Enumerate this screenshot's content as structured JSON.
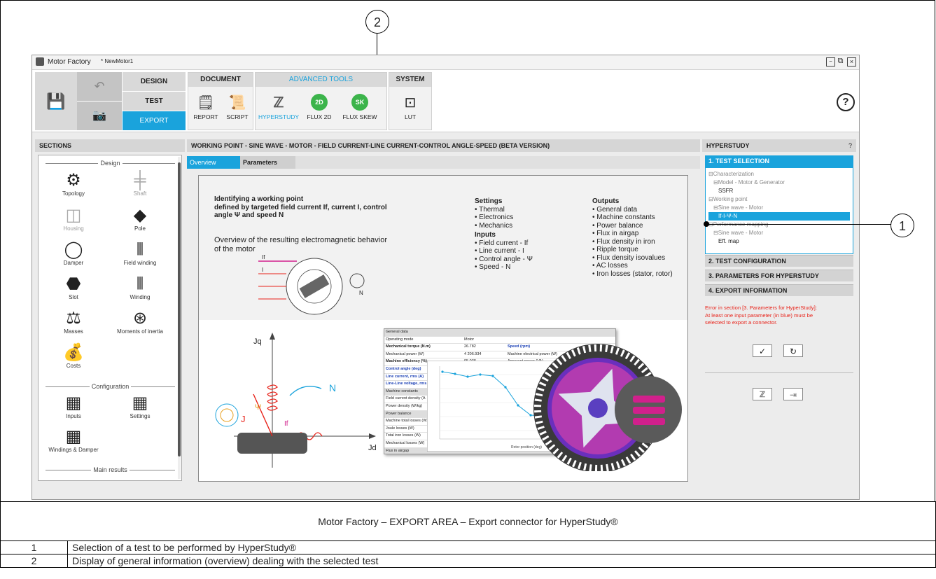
{
  "titlebar": {
    "app_name": "Motor Factory",
    "doc_name": "* NewMotor1",
    "window_controls": [
      "minimize-icon",
      "restore-icon",
      "close-icon"
    ]
  },
  "ribbon": {
    "mode_buttons": [
      "DESIGN",
      "TEST",
      "EXPORT"
    ],
    "groups": [
      {
        "title": "DOCUMENT",
        "tools": [
          "REPORT",
          "SCRIPT"
        ]
      },
      {
        "title": "ADVANCED TOOLS",
        "tools": [
          "HYPERSTUDY",
          "FLUX 2D",
          "FLUX SKEW"
        ]
      },
      {
        "title": "SYSTEM",
        "tools": [
          "LUT"
        ]
      }
    ],
    "help": "?",
    "flux2d_badge": "2D",
    "fluxskew_badge": "SK"
  },
  "sections": {
    "header": "SECTIONS",
    "design_label": "Design",
    "design_items": [
      "Topology",
      "Shaft",
      "Housing",
      "Pole",
      "Damper",
      "Field winding",
      "Slot",
      "Winding",
      "Masses",
      "Moments of inertia",
      "Costs"
    ],
    "configuration_label": "Configuration",
    "configuration_items": [
      "Inputs",
      "Settings",
      "Windings & Damper"
    ],
    "main_results_label": "Main results"
  },
  "main": {
    "header": "WORKING POINT - SINE WAVE - MOTOR - FIELD CURRENT-LINE CURRENT-CONTROL ANGLE-SPEED (BETA VERSION)",
    "tabs": [
      "Overview",
      "Parameters"
    ],
    "overview": {
      "title_line1": "Identifying a working point",
      "title_line2": "defined by targeted field current If, current I, control",
      "title_line3": "angle Ψ and speed N",
      "subtitle_line1": "Overview of the resulting electromagnetic behavior",
      "subtitle_line2": "of the motor",
      "settings_title": "Settings",
      "settings": [
        "Thermal",
        "Electronics",
        "Mechanics"
      ],
      "inputs_title": "Inputs",
      "inputs": [
        "Field current - If",
        "Line current - I",
        "Control angle - Ψ",
        "Speed - N"
      ],
      "outputs_title": "Outputs",
      "outputs": [
        "General data",
        "Machine constants",
        "Power balance",
        "Flux in airgap",
        "Flux density in iron",
        "Ripple torque",
        "Flux density isovalues",
        "AC losses",
        "Iron losses (stator, rotor)"
      ],
      "diagram_labels": {
        "jq": "Jq",
        "jd": "Jd",
        "n": "N",
        "psi": "Ψ",
        "j": "J",
        "if": "If",
        "if_top": "If",
        "i_top": "I"
      },
      "table_rows": [
        [
          "General data",
          "",
          ""
        ],
        [
          "Operating mode",
          "Motor",
          ""
        ],
        [
          "Mechanical torque (N.m)",
          "26.782",
          "Speed (rpm)"
        ],
        [
          "Mechanical power (W)",
          "4 206.934",
          "Machine electrical power (W)"
        ],
        [
          "Machine efficiency (%)",
          "95.038",
          "Apparent power (VA)"
        ],
        [
          "Control angle (deg)",
          "",
          ""
        ],
        [
          "Line current, rms (A)",
          "",
          ""
        ],
        [
          "Line-Line voltage, rms",
          "",
          ""
        ],
        [
          "Machine constants",
          "",
          ""
        ],
        [
          "Field current density (A",
          "",
          ""
        ],
        [
          "Power density (W/kg)",
          "",
          ""
        ],
        [
          "Power balance",
          "",
          ""
        ],
        [
          "Machine total losses (W)",
          "",
          ""
        ],
        [
          "Joule losses (W)",
          "",
          ""
        ],
        [
          "Total iron losses (W)",
          "",
          ""
        ],
        [
          "Mechanical losses (W)",
          "",
          ""
        ],
        [
          "Flux in airgap",
          "",
          ""
        ]
      ],
      "plot_xlabel": "Rotor position (deg)"
    }
  },
  "hyperstudy": {
    "header": "HYPERSTUDY",
    "help": "?",
    "steps": [
      "1. TEST SELECTION",
      "2. TEST CONFIGURATION",
      "3. PARAMETERS FOR HYPERSTUDY",
      "4. EXPORT INFORMATION"
    ],
    "tree": [
      {
        "text": "⊟Characterization",
        "indent": 0,
        "style": "grey"
      },
      {
        "text": "⊟Model - Motor & Generator",
        "indent": 1,
        "style": "grey"
      },
      {
        "text": "SSFR",
        "indent": 2,
        "style": "dark"
      },
      {
        "text": "⊟Working point",
        "indent": 0,
        "style": "grey"
      },
      {
        "text": "⊟Sine wave - Motor",
        "indent": 1,
        "style": "grey"
      },
      {
        "text": "If-I-Ψ-N",
        "indent": 2,
        "style": "selected"
      },
      {
        "text": "⊟Performance mapping",
        "indent": 0,
        "style": "grey"
      },
      {
        "text": "⊟Sine wave - Motor",
        "indent": 1,
        "style": "grey"
      },
      {
        "text": "Eff. map",
        "indent": 2,
        "style": "dark"
      }
    ],
    "error_line1": "Error in section [3. Parameters for HyperStudy]:",
    "error_line2": "At least one input parameter (in blue) must be",
    "error_line3": "selected to export a connector.",
    "ok_symbol": "✓",
    "reset_symbol": "↻"
  },
  "callouts": {
    "c1": "1",
    "c2": "2"
  },
  "caption": {
    "title": "Motor Factory – EXPORT AREA – Export connector for HyperStudy®",
    "rows": [
      {
        "num": "1",
        "text": "Selection of a test to be performed by HyperStudy®"
      },
      {
        "num": "2",
        "text": "Display of general information (overview) dealing with the selected test"
      }
    ]
  },
  "colors": {
    "accent": "#1aa3dc",
    "green": "#3cb44b",
    "error": "#e8231a",
    "magenta": "#d1208c"
  }
}
